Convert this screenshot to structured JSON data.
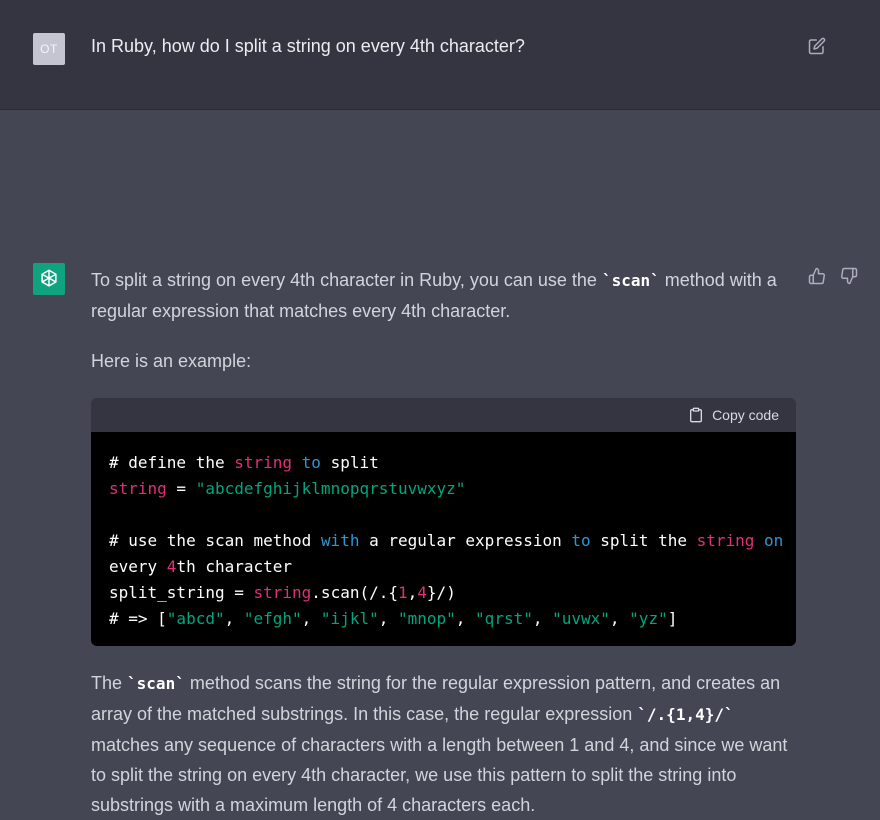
{
  "user": {
    "avatar_initials": "OT",
    "question": "In Ruby, how do I split a string on every 4th character?"
  },
  "assistant": {
    "p1_a": "To split a string on every 4th character in Ruby, you can use the ",
    "p1_code": "`scan`",
    "p1_b": " method with a regular expression that matches every 4th character.",
    "p2": "Here is an example:",
    "copy_label": "Copy code",
    "code": {
      "l1_a": "# define the ",
      "l1_b": "string",
      "l1_c": " ",
      "l1_d": "to",
      "l1_e": " split",
      "l2_a": "string",
      "l2_b": " = ",
      "l2_c": "\"abcdefghijklmnopqrstuvwxyz\"",
      "l4_a": "# use the scan method ",
      "l4_b": "with",
      "l4_c": " a regular expression ",
      "l4_d": "to",
      "l4_e": " split the ",
      "l4_f": "string",
      "l4_g": " ",
      "l4_h": "on",
      "l5_a": "every ",
      "l5_b": "4",
      "l5_c": "th character",
      "l6_a": "split_string = ",
      "l6_b": "string",
      "l6_c": ".scan(/.{",
      "l6_d": "1",
      "l6_e": ",",
      "l6_f": "4",
      "l6_g": "}/)",
      "l7_a": "# => [",
      "l7_items": [
        "\"abcd\"",
        "\"efgh\"",
        "\"ijkl\"",
        "\"mnop\"",
        "\"qrst\"",
        "\"uvwx\"",
        "\"yz\""
      ],
      "l7_sep": ", ",
      "l7_end": "]"
    },
    "p3_a": "The ",
    "p3_code1": "`scan`",
    "p3_b": " method scans the string for the regular expression pattern, and creates an array of the matched substrings. In this case, the regular expression ",
    "p3_code2": "`/.{1,4}/`",
    "p3_c": " matches any sequence of characters with a length between 1 and 4, and since we want to split the string on every 4th character, we use this pattern to split the string into substrings with a maximum length of 4 characters each."
  },
  "colors": {
    "user_bg": "#343541",
    "assistant_bg": "#444654",
    "avatar_bot": "#10a37f",
    "code_string": "#00a67d",
    "code_keyword": "#df3079",
    "code_keyword2": "#2e95d3"
  },
  "icons": [
    "edit-icon",
    "openai-logo-icon",
    "thumbs-up-icon",
    "thumbs-down-icon",
    "clipboard-icon"
  ]
}
